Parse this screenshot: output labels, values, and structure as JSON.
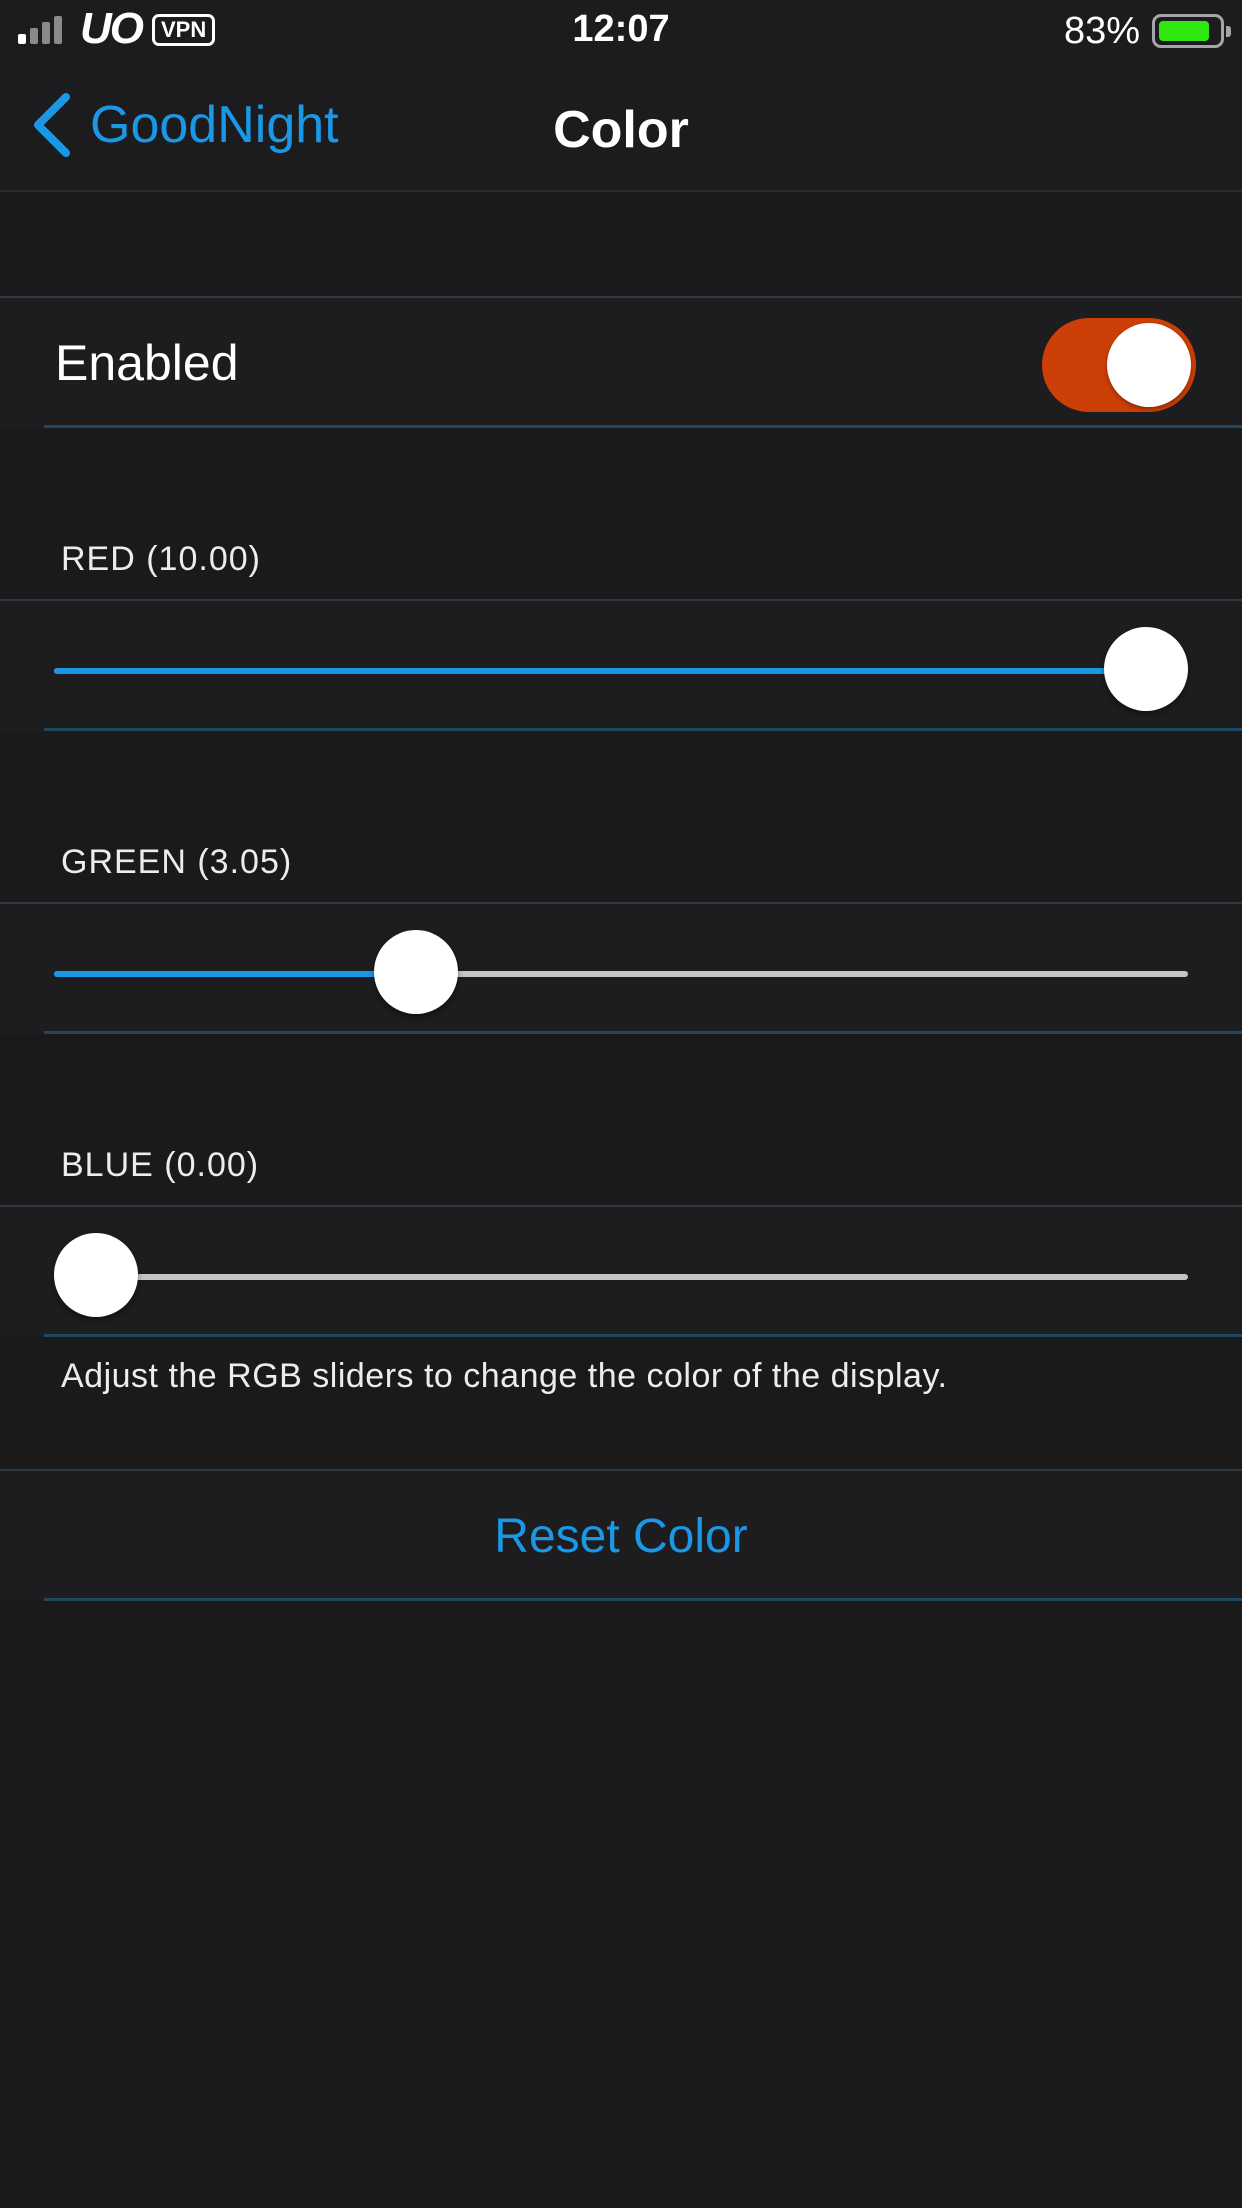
{
  "status_bar": {
    "carrier": "UO",
    "vpn": "VPN",
    "time": "12:07",
    "battery_percent": "83%",
    "battery_level": 0.83,
    "signal_bars_active": 1,
    "signal_bars_total": 4
  },
  "nav": {
    "back_label": "GoodNight",
    "back_icon": "chevron-left-icon",
    "title": "Color"
  },
  "enabled": {
    "label": "Enabled",
    "value": true
  },
  "sliders": [
    {
      "key": "red",
      "header": "RED (10.00)",
      "value": 10.0,
      "min": 0,
      "max": 10
    },
    {
      "key": "green",
      "header": "GREEN (3.05)",
      "value": 3.05,
      "min": 0,
      "max": 10
    },
    {
      "key": "blue",
      "header": "BLUE (0.00)",
      "value": 0.0,
      "min": 0,
      "max": 10
    }
  ],
  "footer_note": "Adjust the RGB sliders to change the color of the display.",
  "reset_label": "Reset Color",
  "colors": {
    "accent": "#1a98e6",
    "toggle_on": "#cc3f07",
    "background": "#1a1a1b",
    "cell": "#1d1d1f",
    "battery": "#30e80f"
  }
}
